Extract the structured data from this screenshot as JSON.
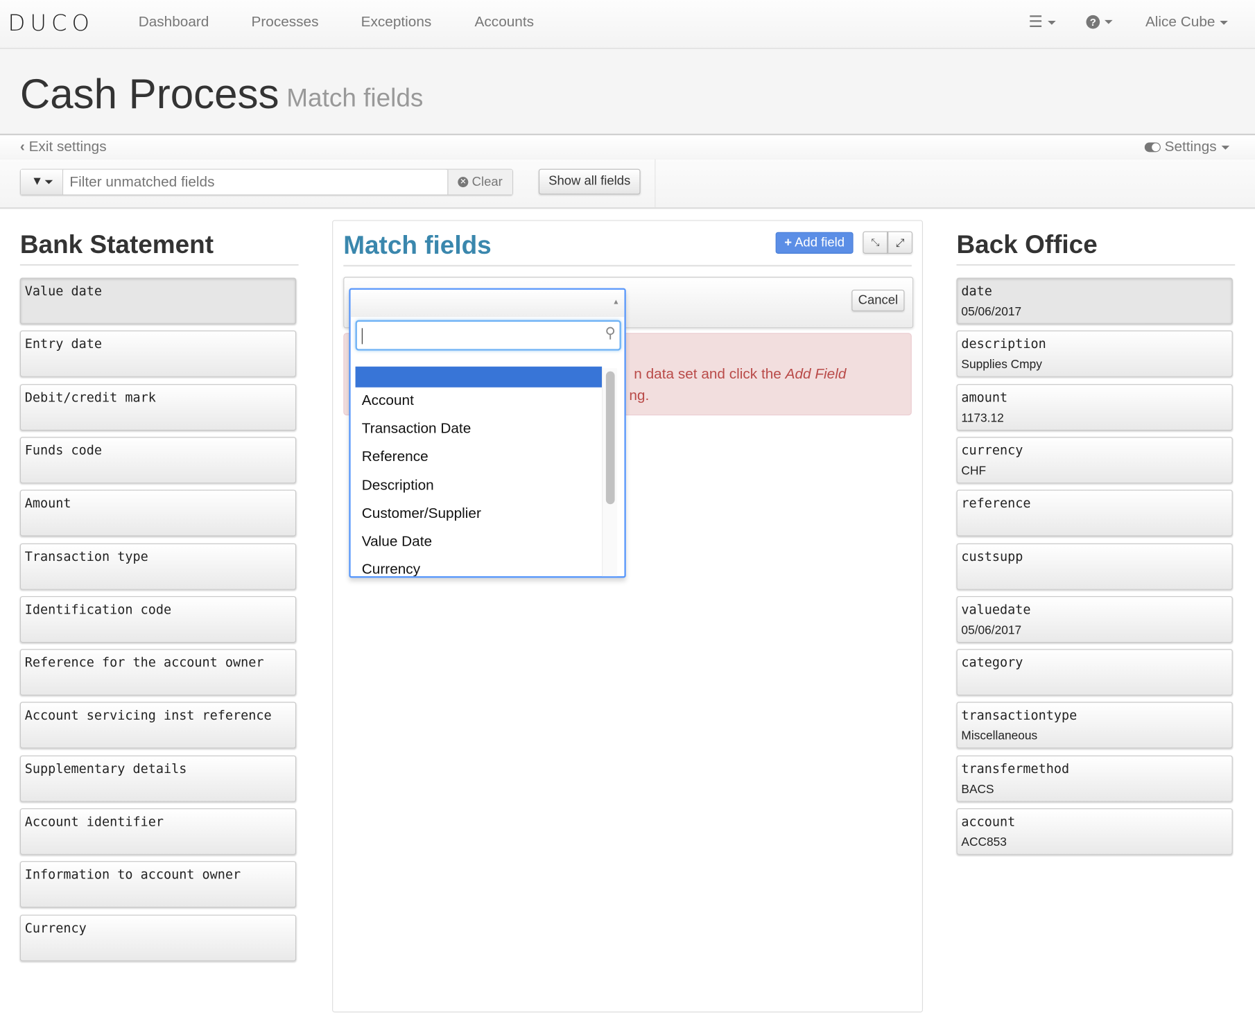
{
  "navbar": {
    "logo": "DUCO",
    "items": [
      "Dashboard",
      "Processes",
      "Exceptions",
      "Accounts"
    ],
    "user": "Alice Cube"
  },
  "page": {
    "title": "Cash Process",
    "subtitle": "Match fields"
  },
  "subnav": {
    "exit": "Exit settings",
    "settings": "Settings"
  },
  "filter": {
    "placeholder": "Filter unmatched fields",
    "clear": "Clear",
    "show_all": "Show all fields"
  },
  "left": {
    "title": "Bank Statement",
    "fields": [
      {
        "label": "Value date",
        "value": ""
      },
      {
        "label": "Entry date",
        "value": ""
      },
      {
        "label": "Debit/credit mark",
        "value": ""
      },
      {
        "label": "Funds code",
        "value": ""
      },
      {
        "label": "Amount",
        "value": ""
      },
      {
        "label": "Transaction type",
        "value": ""
      },
      {
        "label": "Identification code",
        "value": ""
      },
      {
        "label": "Reference for the account owner",
        "value": ""
      },
      {
        "label": "Account servicing inst reference",
        "value": ""
      },
      {
        "label": "Supplementary details",
        "value": ""
      },
      {
        "label": "Account identifier",
        "value": ""
      },
      {
        "label": "Information to account owner",
        "value": ""
      },
      {
        "label": "Currency",
        "value": ""
      }
    ]
  },
  "center": {
    "title": "Match fields",
    "add_field": "Add field",
    "cancel": "Cancel",
    "alert": {
      "line1": "n data set and click the ",
      "line1_em": "Add Field",
      "line2": "ng."
    },
    "dropdown": {
      "search_value": "",
      "options": [
        "",
        "Account",
        "Transaction Date",
        "Reference",
        "Description",
        "Customer/Supplier",
        "Value Date",
        "Currency"
      ],
      "highlighted": 0
    }
  },
  "right": {
    "title": "Back Office",
    "fields": [
      {
        "label": "date",
        "value": "05/06/2017"
      },
      {
        "label": "description",
        "value": "Supplies Cmpy"
      },
      {
        "label": "amount",
        "value": "1173.12"
      },
      {
        "label": "currency",
        "value": "CHF"
      },
      {
        "label": "reference",
        "value": ""
      },
      {
        "label": "custsupp",
        "value": ""
      },
      {
        "label": "valuedate",
        "value": "05/06/2017"
      },
      {
        "label": "category",
        "value": ""
      },
      {
        "label": "transactiontype",
        "value": "Miscellaneous"
      },
      {
        "label": "transfermethod",
        "value": "BACS"
      },
      {
        "label": "account",
        "value": "ACC853"
      }
    ]
  },
  "colors": {
    "accent": "#3a87ad",
    "add_button": "#5b8ee6",
    "highlight": "#3875d7",
    "alert_bg": "#f2dede",
    "alert_text": "#b94a48"
  }
}
